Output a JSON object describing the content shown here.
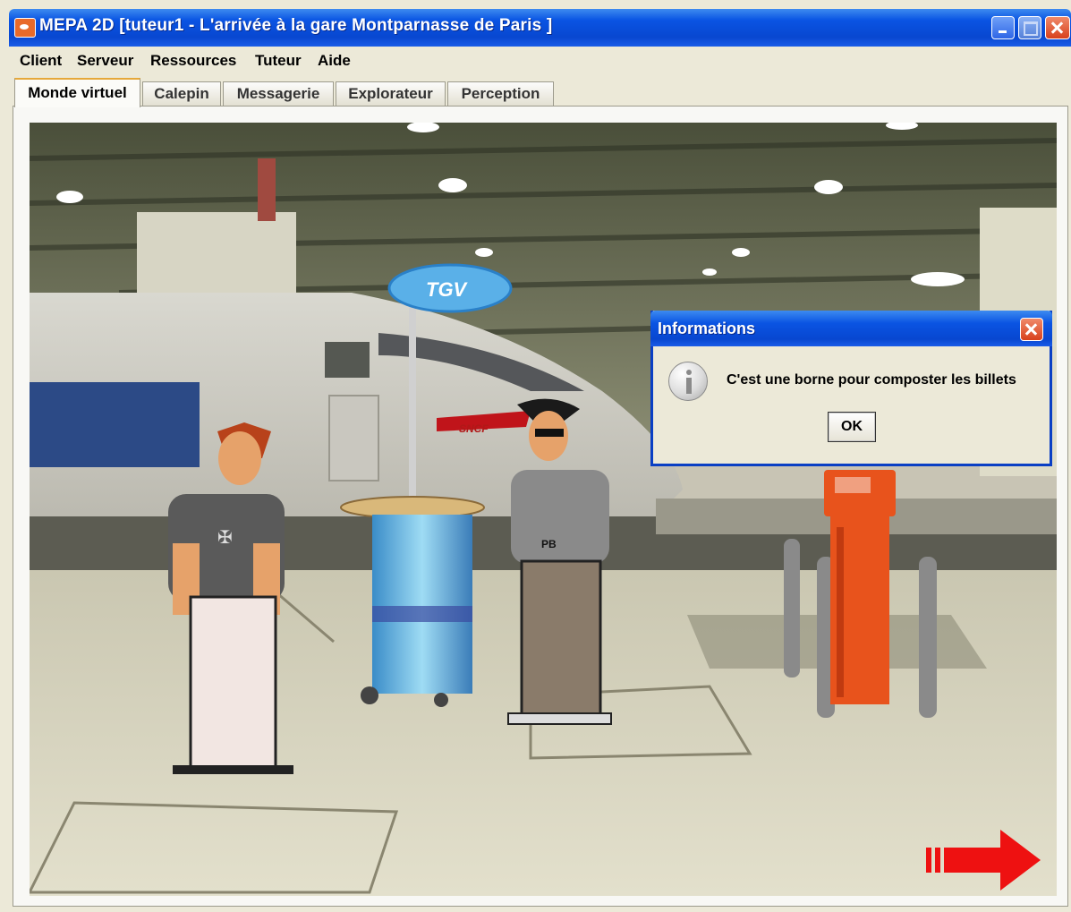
{
  "window": {
    "title": "MEPA 2D [tuteur1 - L'arrivée à la gare Montparnasse de Paris ]"
  },
  "menu": {
    "items": [
      "Client",
      "Serveur",
      "Ressources",
      "Tuteur",
      "Aide"
    ]
  },
  "tabs": [
    {
      "label": "Monde virtuel",
      "active": true
    },
    {
      "label": "Calepin",
      "active": false
    },
    {
      "label": "Messagerie",
      "active": false
    },
    {
      "label": "Explorateur",
      "active": false
    },
    {
      "label": "Perception",
      "active": false
    }
  ],
  "scene": {
    "sign_text": "TGV",
    "train_text": "SNCF",
    "shirt_text": "PB"
  },
  "dialog": {
    "title": "Informations",
    "message": "C'est une borne pour composter les billets",
    "ok_label": "OK",
    "icon": "info-icon"
  },
  "colors": {
    "titlebar": "#0a54e3",
    "window_bg": "#ece9d8",
    "close_red": "#d8401c",
    "arrow_red": "#ee1111",
    "composteur_orange": "#e8531c"
  }
}
